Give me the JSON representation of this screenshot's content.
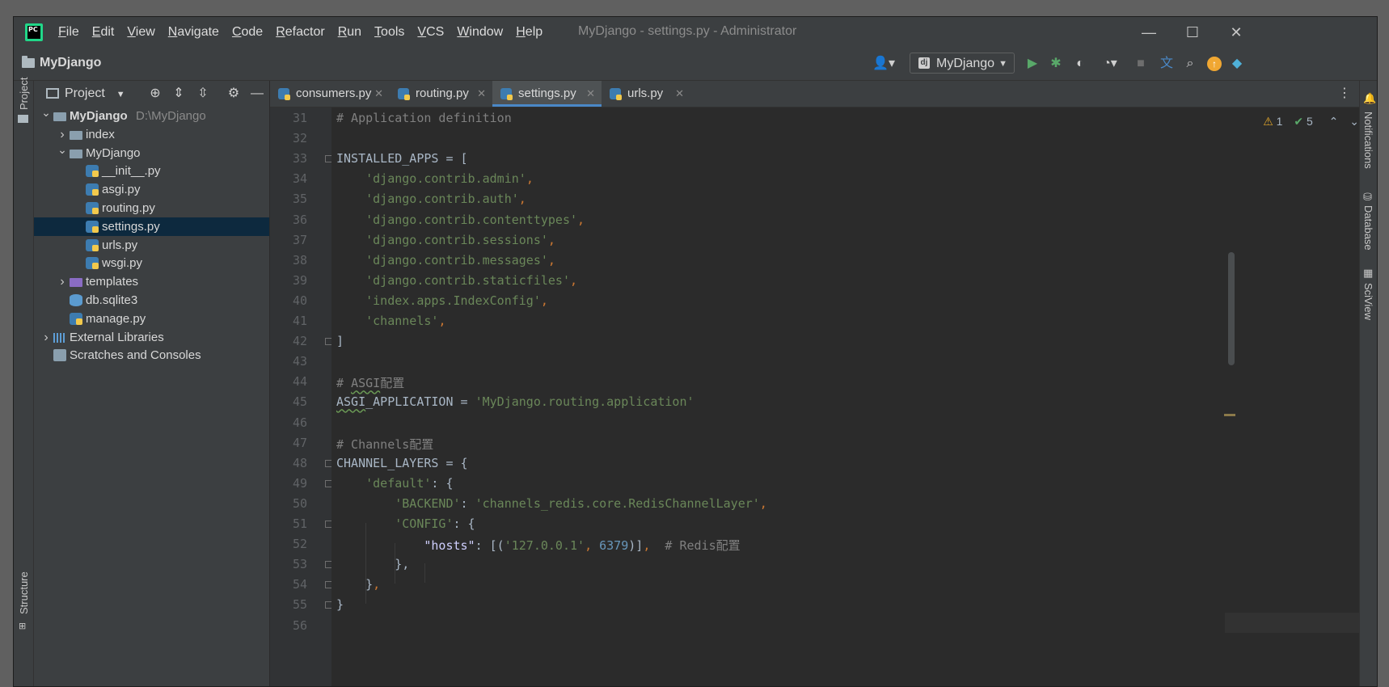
{
  "window": {
    "app_logo_text": "PC",
    "menu": [
      {
        "u": "F",
        "rest": "ile"
      },
      {
        "u": "E",
        "rest": "dit"
      },
      {
        "u": "V",
        "rest": "iew"
      },
      {
        "u": "N",
        "rest": "avigate"
      },
      {
        "u": "C",
        "rest": "ode"
      },
      {
        "u": "R",
        "rest": "efactor"
      },
      {
        "u": "R",
        "rest": "un"
      },
      {
        "u": "T",
        "rest": "ools"
      },
      {
        "u": "V",
        "rest": "CS"
      },
      {
        "u": "W",
        "rest": "indow"
      },
      {
        "u": "H",
        "rest": "elp"
      }
    ],
    "title": "MyDjango - settings.py - Administrator",
    "controls": {
      "minimize": "—",
      "maximize": "☐",
      "close": "✕"
    }
  },
  "navbar": {
    "breadcrumb": "MyDjango",
    "run_config": "MyDjango",
    "run_config_icon": "dj"
  },
  "project": {
    "title": "Project",
    "tree": [
      {
        "label": "MyDjango",
        "hint": "D:\\MyDjango",
        "indent": 0,
        "arrow": "⌄",
        "icon": "folder",
        "bold": true
      },
      {
        "label": "index",
        "indent": 1,
        "arrow": "›",
        "icon": "folder"
      },
      {
        "label": "MyDjango",
        "indent": 1,
        "arrow": "⌄",
        "icon": "folder"
      },
      {
        "label": "__init__.py",
        "indent": 2,
        "icon": "py"
      },
      {
        "label": "asgi.py",
        "indent": 2,
        "icon": "py"
      },
      {
        "label": "routing.py",
        "indent": 2,
        "icon": "py"
      },
      {
        "label": "settings.py",
        "indent": 2,
        "icon": "py",
        "selected": true
      },
      {
        "label": "urls.py",
        "indent": 2,
        "icon": "py"
      },
      {
        "label": "wsgi.py",
        "indent": 2,
        "icon": "py"
      },
      {
        "label": "templates",
        "indent": 1,
        "arrow": "›",
        "icon": "folder-purple"
      },
      {
        "label": "db.sqlite3",
        "indent": 1,
        "icon": "db"
      },
      {
        "label": "manage.py",
        "indent": 1,
        "icon": "py"
      },
      {
        "label": "External Libraries",
        "indent": 0,
        "arrow": "›",
        "icon": "lib"
      },
      {
        "label": "Scratches and Consoles",
        "indent": 0,
        "icon": "scratch"
      }
    ]
  },
  "side_left": {
    "project_tab": "Project",
    "structure_tab": "Structure"
  },
  "side_right": {
    "notifications_tab": "Notifications",
    "database_tab": "Database",
    "sciview_tab": "SciView"
  },
  "tabs": [
    {
      "label": "consumers.py",
      "close": "✕"
    },
    {
      "label": "routing.py",
      "close": "✕"
    },
    {
      "label": "settings.py",
      "close": "✕",
      "active": true
    },
    {
      "label": "urls.py",
      "close": "✕"
    }
  ],
  "inspections": {
    "warnings": "1",
    "weak_warnings": "5"
  },
  "editor": {
    "lines": [
      {
        "n": "31",
        "parts": [
          [
            "c",
            "# Application definition"
          ]
        ]
      },
      {
        "n": "32",
        "parts": []
      },
      {
        "n": "33",
        "parts": [
          [
            "k",
            "INSTALLED_APPS = ["
          ]
        ],
        "fold": true
      },
      {
        "n": "34",
        "parts": [
          [
            "k",
            "    "
          ],
          [
            "s",
            "'django.contrib.admin'"
          ],
          [
            "o",
            ","
          ]
        ]
      },
      {
        "n": "35",
        "parts": [
          [
            "k",
            "    "
          ],
          [
            "s",
            "'django.contrib.auth'"
          ],
          [
            "o",
            ","
          ]
        ]
      },
      {
        "n": "36",
        "parts": [
          [
            "k",
            "    "
          ],
          [
            "s",
            "'django.contrib.contenttypes'"
          ],
          [
            "o",
            ","
          ]
        ]
      },
      {
        "n": "37",
        "parts": [
          [
            "k",
            "    "
          ],
          [
            "s",
            "'django.contrib.sessions'"
          ],
          [
            "o",
            ","
          ]
        ]
      },
      {
        "n": "38",
        "parts": [
          [
            "k",
            "    "
          ],
          [
            "s",
            "'django.contrib.messages'"
          ],
          [
            "o",
            ","
          ]
        ]
      },
      {
        "n": "39",
        "parts": [
          [
            "k",
            "    "
          ],
          [
            "s",
            "'django.contrib.staticfiles'"
          ],
          [
            "o",
            ","
          ]
        ]
      },
      {
        "n": "40",
        "parts": [
          [
            "k",
            "    "
          ],
          [
            "s",
            "'index.apps.IndexConfig'"
          ],
          [
            "o",
            ","
          ]
        ]
      },
      {
        "n": "41",
        "parts": [
          [
            "k",
            "    "
          ],
          [
            "s",
            "'channels'"
          ],
          [
            "o",
            ","
          ]
        ]
      },
      {
        "n": "42",
        "parts": [
          [
            "k",
            "]"
          ]
        ],
        "fold": true
      },
      {
        "n": "43",
        "parts": []
      },
      {
        "n": "44",
        "parts": [
          [
            "c",
            "# "
          ],
          [
            "cq",
            "ASGI"
          ],
          [
            "c",
            "配置"
          ]
        ]
      },
      {
        "n": "45",
        "parts": [
          [
            "kq",
            "ASGI"
          ],
          [
            "k",
            "_APPLICATION = "
          ],
          [
            "s",
            "'MyDjango.routing.application'"
          ]
        ]
      },
      {
        "n": "46",
        "parts": []
      },
      {
        "n": "47",
        "parts": [
          [
            "c",
            "# Channels配置"
          ]
        ]
      },
      {
        "n": "48",
        "parts": [
          [
            "k",
            "CHANNEL_LAYERS = {"
          ]
        ],
        "fold": true
      },
      {
        "n": "49",
        "parts": [
          [
            "k",
            "    "
          ],
          [
            "s",
            "'default'"
          ],
          [
            "k",
            ": {"
          ]
        ],
        "fold": true
      },
      {
        "n": "50",
        "parts": [
          [
            "k",
            "        "
          ],
          [
            "s",
            "'BACKEND'"
          ],
          [
            "k",
            ": "
          ],
          [
            "s",
            "'channels_redis.core.RedisChannelLayer'"
          ],
          [
            "o",
            ","
          ]
        ]
      },
      {
        "n": "51",
        "parts": [
          [
            "k",
            "        "
          ],
          [
            "s",
            "'CONFIG'"
          ],
          [
            "k",
            ": {"
          ]
        ],
        "fold": true
      },
      {
        "n": "52",
        "parts": [
          [
            "k",
            "            "
          ],
          [
            "d",
            "\"hosts\""
          ],
          [
            "k",
            ": [("
          ],
          [
            "s",
            "'127.0.0.1'"
          ],
          [
            "o",
            ", "
          ],
          [
            "n",
            "6379"
          ],
          [
            "k",
            ")]"
          ],
          [
            "o",
            ","
          ],
          [
            "k",
            "  "
          ],
          [
            "c",
            "# Redis配置"
          ]
        ]
      },
      {
        "n": "53",
        "parts": [
          [
            "k",
            "        },"
          ]
        ],
        "fold": true
      },
      {
        "n": "54",
        "parts": [
          [
            "k",
            "    }"
          ],
          [
            "o",
            ","
          ]
        ],
        "fold": true
      },
      {
        "n": "55",
        "parts": [
          [
            "k",
            "}"
          ]
        ],
        "fold": true
      },
      {
        "n": "56",
        "parts": []
      }
    ]
  }
}
